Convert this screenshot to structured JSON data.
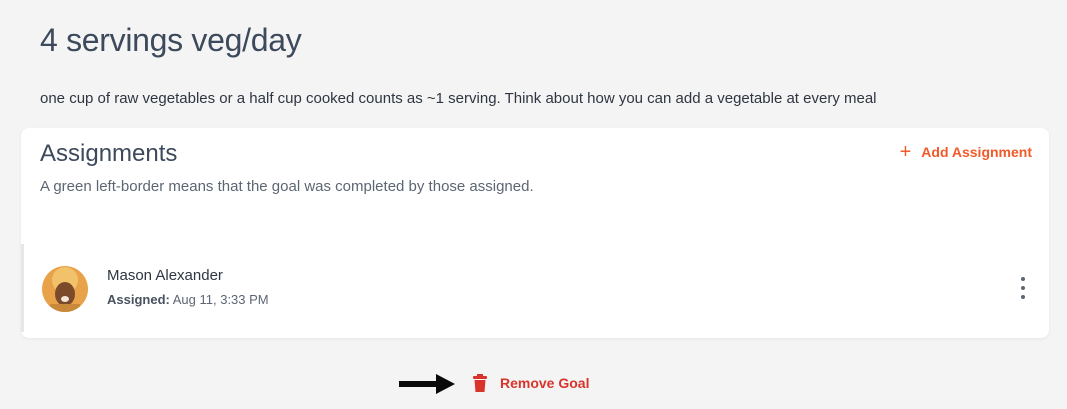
{
  "goal": {
    "title": "4 servings veg/day",
    "description": "one cup of raw vegetables or a half cup cooked counts as ~1 serving. Think about how you can add a vegetable at every meal"
  },
  "assignments": {
    "title": "Assignments",
    "subtitle": "A green left-border means that the goal was completed by those assigned.",
    "add_label": "Add Assignment",
    "items": [
      {
        "name": "Mason Alexander",
        "assigned_label": "Assigned:",
        "assigned_value": "Aug 11, 3:33 PM",
        "completed": false
      }
    ]
  },
  "actions": {
    "remove_label": "Remove Goal"
  },
  "icons": [
    "plus-icon",
    "kebab-menu-icon",
    "arrow-right-icon",
    "trash-icon"
  ],
  "colors": {
    "accent": "#f15a29",
    "danger": "#d9342b",
    "background": "#f4f4f5"
  }
}
